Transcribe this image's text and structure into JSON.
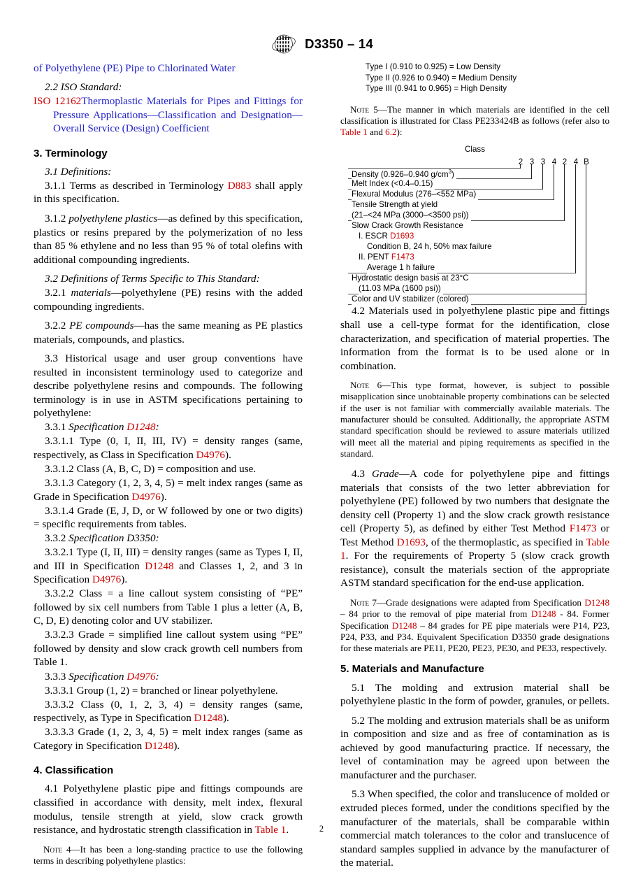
{
  "header": {
    "logo_alt": "ASTM International logo",
    "designation": "D3350 – 14"
  },
  "page_number": "2",
  "left_column": {
    "ref_continuation": "of Polyethylene (PE) Pipe to Chlorinated Water",
    "iso_heading": "2.2 ISO Standard:",
    "iso_ref_id": "ISO 12162",
    "iso_ref_title": "Thermoplastic Materials for Pipes and Fittings for Pressure Applications—Classification and Designation—Overall Service (Design) Coefficient",
    "sec3_heading": "3.  Terminology",
    "p_3_1": "3.1  Definitions:",
    "p_3_1_1_a": "3.1.1  Terms as described in Terminology ",
    "p_3_1_1_ref": "D883",
    "p_3_1_1_b": " shall apply in this specification.",
    "p_3_1_2_num": "3.1.2  ",
    "p_3_1_2_term": "polyethylene plastics",
    "p_3_1_2_body": "—as defined by this specification, plastics or resins prepared by the polymerization of no less than 85 % ethylene and no less than 95 % of total olefins with additional compounding ingredients.",
    "p_3_2": "3.2  Definitions of Terms Specific to This Standard:",
    "p_3_2_1_num": "3.2.1  ",
    "p_3_2_1_term": "materials",
    "p_3_2_1_body": "—polyethylene (PE) resins with the added compounding ingredients.",
    "p_3_2_2_num": "3.2.2  ",
    "p_3_2_2_term": "PE compounds",
    "p_3_2_2_body": "—has the same meaning as PE plastics materials, compounds, and plastics.",
    "p_3_3": "3.3  Historical usage and user group conventions have resulted in inconsistent terminology used to categorize and describe polyethylene resins and compounds. The following terminology is in use in ASTM specifications pertaining to polyethylene:",
    "p_3_3_1_num": "3.3.1  ",
    "p_3_3_1_term": "Specification ",
    "p_3_3_1_ref": "D1248",
    "p_3_3_1_tail": ":",
    "p_3_3_1_1_a": "3.3.1.1  Type (0, I, II, III, IV) = density ranges (same, respectively, as Class in Specification ",
    "p_3_3_1_1_ref": "D4976",
    "p_3_3_1_1_b": ").",
    "p_3_3_1_2": "3.3.1.2  Class (A, B, C, D) = composition and use.",
    "p_3_3_1_3_a": "3.3.1.3  Category (1, 2, 3, 4, 5) = melt index ranges (same as Grade in Specification ",
    "p_3_3_1_3_ref": "D4976",
    "p_3_3_1_3_b": ").",
    "p_3_3_1_4": "3.3.1.4  Grade (E, J, D, or W followed by one or two digits) = specific requirements from tables.",
    "p_3_3_2_num": "3.3.2  ",
    "p_3_3_2_term": "Specification D3350:",
    "p_3_3_2_1_a": "3.3.2.1  Type (I, II, III) = density ranges (same as Types I, II, and III in Specification ",
    "p_3_3_2_1_ref1": "D1248",
    "p_3_3_2_1_b": " and Classes 1, 2, and 3 in Specification ",
    "p_3_3_2_1_ref2": "D4976",
    "p_3_3_2_1_c": ").",
    "p_3_3_2_2": "3.3.2.2  Class = a line callout system consisting of “PE” followed by six cell numbers from Table 1 plus a letter (A, B, C, D, E) denoting color and UV stabilizer.",
    "p_3_3_2_3": "3.3.2.3  Grade = simplified line callout system using “PE” followed by density and slow crack growth cell numbers from Table 1.",
    "p_3_3_3_num": "3.3.3  ",
    "p_3_3_3_term": "Specification ",
    "p_3_3_3_ref": "D4976",
    "p_3_3_3_tail": ":",
    "p_3_3_3_1": "3.3.3.1  Group (1, 2) = branched or linear polyethylene.",
    "p_3_3_3_2_a": "3.3.3.2  Class (0, 1, 2, 3, 4) = density ranges (same, respectively, as Type in Specification ",
    "p_3_3_3_2_ref": "D1248",
    "p_3_3_3_2_b": ").",
    "p_3_3_3_3_a": "3.3.3.3  Grade (1, 2, 3, 4, 5) = melt index ranges (same as Category in Specification ",
    "p_3_3_3_3_ref": "D1248",
    "p_3_3_3_3_b": ").",
    "sec4_heading": "4.  Classification",
    "p_4_1_a": "4.1  Polyethylene plastic pipe and fittings compounds are classified in accordance with density, melt index, flexural modulus, tensile strength at yield, slow crack growth resistance, and hydrostatic strength classification in ",
    "p_4_1_ref": "Table 1",
    "p_4_1_b": ".",
    "note4_label": "Note 4",
    "note4_body": "—It has been a long-standing practice to use the following terms in describing polyethylene plastics:"
  },
  "right_column": {
    "type_list": [
      "Type I (0.910 to 0.925) = Low Density",
      "Type II (0.926 to 0.940) = Medium Density",
      "Type III (0.941 to 0.965) = High Density"
    ],
    "note5_label": "Note 5",
    "note5_a": "—The manner in which materials are identified in the cell classification is illustrated for Class PE233424B as follows (refer also to ",
    "note5_ref1": "Table 1",
    "note5_b": " and ",
    "note5_ref2": "6.2",
    "note5_c": "):",
    "diagram": {
      "title": "Class",
      "cells": [
        "2",
        "3",
        "3",
        "4",
        "2",
        "4",
        "B"
      ],
      "rows": [
        {
          "label": "Density (0.926–0.940 g/cm",
          "sup": "3",
          "label_tail": ")",
          "indent": 0
        },
        {
          "label": "Melt Index (<0.4–0.15)",
          "indent": 0
        },
        {
          "label": "Flexural Modulus (276–<552 MPa)",
          "indent": 0
        },
        {
          "label": "Tensile Strength at yield",
          "indent": 0
        },
        {
          "label": "(21–<24 MPa (3000–<3500 psi))",
          "indent": 0
        },
        {
          "label": "Slow Crack Growth Resistance",
          "indent": 0
        },
        {
          "label": "I. ESCR ",
          "ref": "D1693",
          "indent": 1
        },
        {
          "label": "Condition B, 24 h, 50% max failure",
          "indent": 2
        },
        {
          "label": "II. PENT ",
          "ref": "F1473",
          "indent": 1
        },
        {
          "label": "Average 1 h failure",
          "indent": 2
        },
        {
          "label": "Hydrostatic design basis at 23°C",
          "indent": 0
        },
        {
          "label": "(11.03 MPa (1600 psi))",
          "indent": 1
        },
        {
          "label": "Color and UV stabilizer (colored)",
          "indent": 0
        }
      ]
    },
    "p_4_2": "4.2  Materials used in polyethylene plastic pipe and fittings shall use a cell-type format for the identification, close characterization, and specification of material properties. The information from the format is to be used alone or in combination.",
    "note6_label": "Note 6",
    "note6_body": "—This type format, however, is subject to possible misapplication since unobtainable property combinations can be selected if the user is not familiar with commercially available materials. The manufacturer should be consulted. Additionally, the appropriate ASTM standard specification should be reviewed to assure materials utilized will meet all the material and piping requirements as specified in the standard.",
    "p_4_3_num": "4.3  ",
    "p_4_3_term": "Grade",
    "p_4_3_a": "—A code for polyethylene pipe and fittings materials that consists of the two letter abbreviation for polyethylene (PE) followed by two numbers that designate the density cell (Property 1) and the slow crack growth resistance cell (Property 5), as defined by either Test Method ",
    "p_4_3_ref1": "F1473",
    "p_4_3_b": " or Test Method ",
    "p_4_3_ref2": "D1693",
    "p_4_3_c": ", of the thermoplastic, as specified in ",
    "p_4_3_ref3": "Table 1",
    "p_4_3_d": ". For the requirements of Property 5 (slow crack growth resistance), consult the materials section of the appropriate ASTM standard specification for the end-use application.",
    "note7_label": "Note 7",
    "note7_a": "—Grade designations were adapted from Specification ",
    "note7_ref1": "D1248",
    "note7_b": " – 84 prior to the removal of pipe material from ",
    "note7_ref2": "D1248",
    "note7_c": " - 84. Former Specification ",
    "note7_ref3": "D1248",
    "note7_d": " – 84 grades for PE pipe materials were P14, P23, P24, P33, and P34. Equivalent Specification D3350 grade designations for these materials are PE11, PE20, PE23, PE30, and PE33, respectively.",
    "sec5_heading": "5.  Materials and Manufacture",
    "p_5_1": "5.1  The molding and extrusion material shall be polyethylene plastic in the form of powder, granules, or pellets.",
    "p_5_2": "5.2  The molding and extrusion materials shall be as uniform in composition and size and as free of contamination as is achieved by good manufacturing practice. If necessary, the level of contamination may be agreed upon between the manufacturer and the purchaser.",
    "p_5_3": "5.3  When specified, the color and translucence of molded or extruded pieces formed, under the conditions specified by the manufacturer of the materials, shall be comparable within commercial match tolerances to the color and translucence of standard samples supplied in advance by the manufacturer of the material."
  },
  "colors": {
    "reference_red": "#cc0000",
    "reference_blue": "#2222cc",
    "text": "#000000"
  }
}
